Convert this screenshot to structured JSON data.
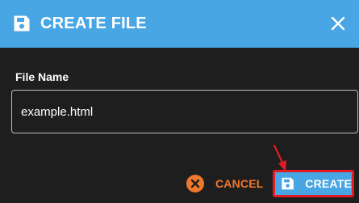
{
  "dialog": {
    "title": "CREATE FILE",
    "header_icon": "floppy-disk-icon",
    "close_icon": "close-icon"
  },
  "form": {
    "label": "File Name",
    "value": "example.html"
  },
  "actions": {
    "cancel_label": "CANCEL",
    "cancel_icon": "cancel-circle-icon",
    "create_label": "CREATE",
    "create_icon": "floppy-disk-icon"
  },
  "colors": {
    "header_bg": "#48a6e4",
    "dialog_bg": "#1e1e1e",
    "cancel_accent": "#f0782d",
    "highlight": "#e31b23"
  }
}
